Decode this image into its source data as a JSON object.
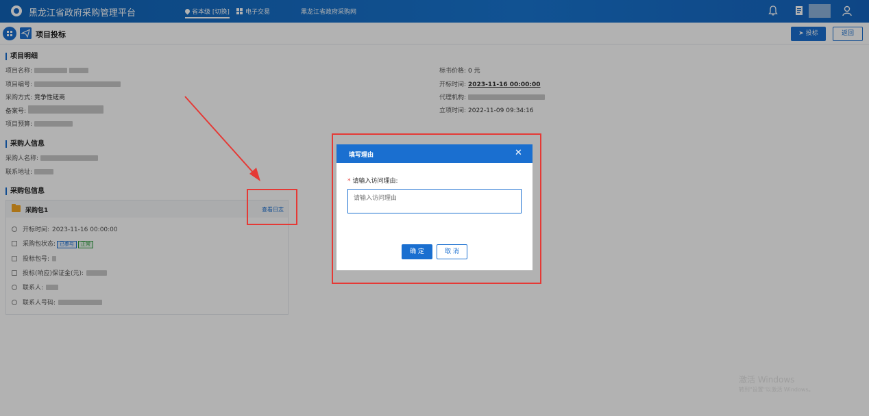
{
  "header": {
    "app_title": "黑龙江省政府采购管理平台",
    "region_label": "省本级 [切换]",
    "nav_exchange": "电子交易",
    "nav_site": "黑龙江省政府采购网"
  },
  "subheader": {
    "page_title": "项目投标",
    "bid_button": "投标",
    "back_button": "返回"
  },
  "project_detail": {
    "section_title": "项目明细",
    "left": [
      {
        "label": "项目名称:",
        "value": ""
      },
      {
        "label": "项目编号:",
        "value": ""
      },
      {
        "label": "采购方式:",
        "value": "竞争性磋商"
      },
      {
        "label": "备案号:",
        "value": ""
      },
      {
        "label": "项目预算:",
        "value": ""
      }
    ],
    "right": [
      {
        "label": "标书价格:",
        "value": "0 元"
      },
      {
        "label": "开标时间:",
        "value": "2023-11-16 00:00:00"
      },
      {
        "label": "代理机构:",
        "value": ""
      },
      {
        "label": "立项时间:",
        "value": "2022-11-09 09:34:16"
      }
    ]
  },
  "purchaser": {
    "section_title": "采购人信息",
    "rows": [
      {
        "label": "采购人名称:",
        "value": ""
      },
      {
        "label": "联系地址:",
        "value": ""
      }
    ]
  },
  "package": {
    "section_title": "采购包信息",
    "name": "采购包1",
    "view_log": "查看日志",
    "open_time_label": "开标时间:",
    "open_time_value": "2023-11-16 00:00:00",
    "status_label": "采购包状态:",
    "status_tags": [
      "已参与",
      "正常"
    ],
    "bid_no_label": "投标包号:",
    "deposit_label": "投标(响应)保证金(元):",
    "contact_label": "联系人:",
    "phone_label": "联系人号码:"
  },
  "modal": {
    "title": "填写理由",
    "close": "✕",
    "field_label": "请输入访问理由:",
    "required_mark": "*",
    "placeholder": "请输入访问理由",
    "ok": "确 定",
    "cancel": "取 消"
  },
  "watermark": {
    "line1": "激活 Windows",
    "line2": "转到\"设置\"以激活 Windows。"
  },
  "colors": {
    "primary": "#1a6fd0",
    "danger": "#e53935",
    "annotation": "#e53935"
  }
}
